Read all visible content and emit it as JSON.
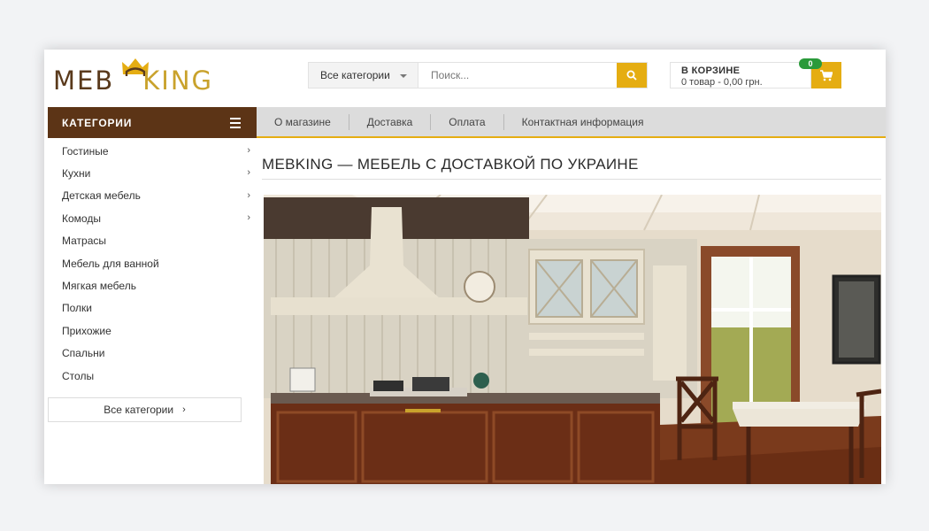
{
  "header": {
    "logo": {
      "left": "MEB",
      "right": "KING"
    },
    "search": {
      "category": "Все категории",
      "placeholder": "Поиск..."
    },
    "cart": {
      "title": "В КОРЗИНЕ",
      "summary": "0 товар - 0,00 грн.",
      "count": "0"
    }
  },
  "sidebar": {
    "header": "КАТЕГОРИИ",
    "items": [
      {
        "label": "Гостиные",
        "has_children": true
      },
      {
        "label": "Кухни",
        "has_children": true
      },
      {
        "label": "Детская мебель",
        "has_children": true
      },
      {
        "label": "Комоды",
        "has_children": true
      },
      {
        "label": "Матрасы",
        "has_children": false
      },
      {
        "label": "Мебель для ванной",
        "has_children": false
      },
      {
        "label": "Мягкая мебель",
        "has_children": false
      },
      {
        "label": "Полки",
        "has_children": false
      },
      {
        "label": "Прихожие",
        "has_children": false
      },
      {
        "label": "Спальни",
        "has_children": false
      },
      {
        "label": "Столы",
        "has_children": false
      }
    ],
    "all_categories": "Все категории"
  },
  "nav": {
    "items": [
      "О магазине",
      "Доставка",
      "Оплата",
      "Контактная информация"
    ]
  },
  "main": {
    "title": "MEBKING — МЕБЕЛЬ С ДОСТАВКОЙ ПО УКРАИНЕ"
  },
  "colors": {
    "brand_brown": "#5c3416",
    "accent_gold": "#e5ad12",
    "badge_green": "#2a9a3a"
  },
  "icons": {
    "search": "search-icon",
    "cart": "cart-icon",
    "menu": "hamburger-icon",
    "chevron": "chevron-right-icon"
  }
}
